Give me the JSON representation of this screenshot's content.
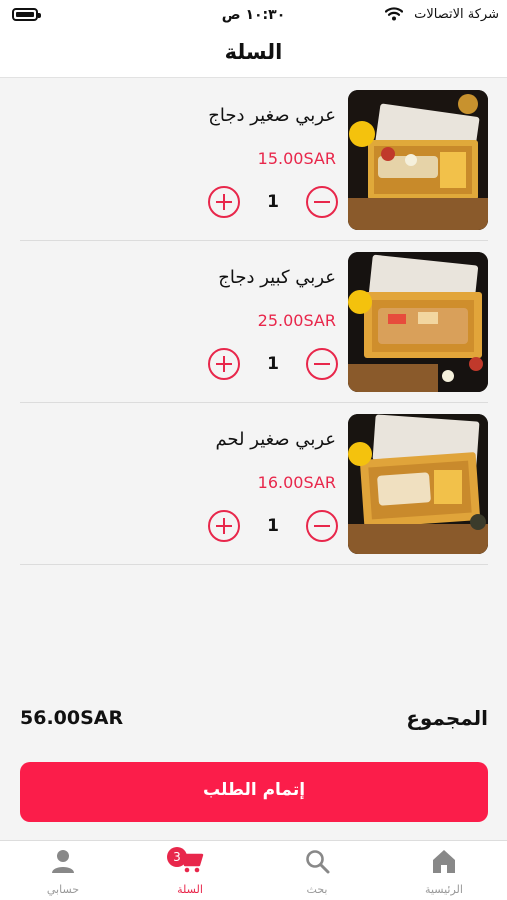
{
  "status_bar": {
    "carrier": "شركة الاتصالات",
    "time": "١٠:٣٠ ص"
  },
  "header": {
    "title": "السلة"
  },
  "cart": {
    "items": [
      {
        "name": "عربي صغير دجاج",
        "price": "15.00SAR",
        "quantity": "1"
      },
      {
        "name": "عربي كبير دجاج",
        "price": "25.00SAR",
        "quantity": "1"
      },
      {
        "name": "عربي صغير لحم",
        "price": "16.00SAR",
        "quantity": "1"
      }
    ]
  },
  "total": {
    "label": "المجموع",
    "value": "56.00SAR"
  },
  "checkout": {
    "label": "إتمام الطلب"
  },
  "tab_bar": {
    "tabs": [
      {
        "label": "الرئيسية",
        "icon": "home-icon"
      },
      {
        "label": "بحث",
        "icon": "search-icon"
      },
      {
        "label": "السلة",
        "icon": "cart-icon",
        "badge": "3",
        "active": true
      },
      {
        "label": "حسابي",
        "icon": "person-icon"
      }
    ]
  },
  "colors": {
    "accent": "#e8274b",
    "button": "#fb1d4a"
  }
}
